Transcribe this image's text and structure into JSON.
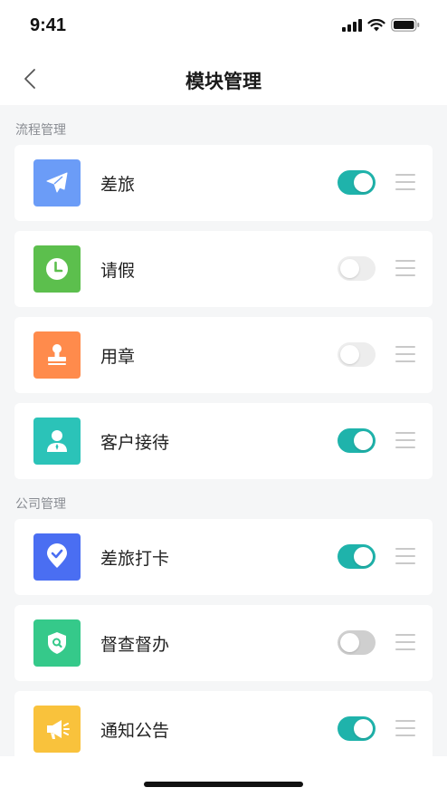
{
  "status_bar": {
    "time": "9:41",
    "icons": [
      "signal-icon",
      "wifi-icon",
      "battery-icon"
    ]
  },
  "nav": {
    "title": "模块管理",
    "back_icon": "chevron-left-icon"
  },
  "sections": [
    {
      "title": "流程管理",
      "items": [
        {
          "label": "差旅",
          "icon": "airplane-icon",
          "color": "#6b9cf7",
          "enabled": true
        },
        {
          "label": "请假",
          "icon": "clock-icon",
          "color": "#5cbf4d",
          "enabled": false
        },
        {
          "label": "用章",
          "icon": "stamp-icon",
          "color": "#ff8b4c",
          "enabled": false
        },
        {
          "label": "客户接待",
          "icon": "person-icon",
          "color": "#2bc3b8",
          "enabled": true
        }
      ]
    },
    {
      "title": "公司管理",
      "items": [
        {
          "label": "差旅打卡",
          "icon": "location-check-icon",
          "color": "#4a6ef2",
          "enabled": true
        },
        {
          "label": "督查督办",
          "icon": "shield-search-icon",
          "color": "#35c98a",
          "enabled": false
        },
        {
          "label": "通知公告",
          "icon": "megaphone-icon",
          "color": "#f9c23c",
          "enabled": true
        }
      ]
    }
  ],
  "colors": {
    "toggle_on": "#1fb3ab",
    "toggle_off": "#ededed",
    "background": "#f5f6f7"
  }
}
